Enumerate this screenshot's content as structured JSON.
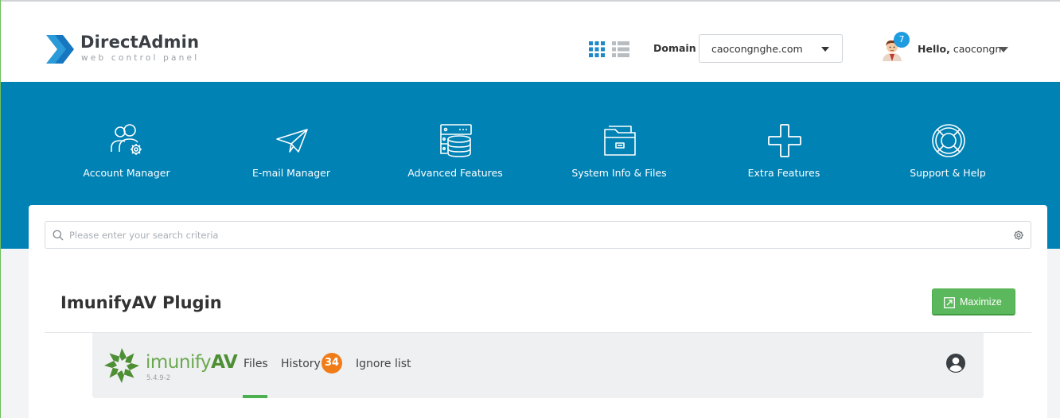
{
  "header": {
    "logo_name": "DirectAdmin",
    "logo_tagline": "web control panel",
    "domain_label": "Domain",
    "domain_value": "caocongnghe.com",
    "notification_count": "7",
    "hello_prefix": "Hello,",
    "username": "caocongn"
  },
  "nav": {
    "items": [
      {
        "label": "Account Manager",
        "icon": "users-gear-icon"
      },
      {
        "label": "E-mail Manager",
        "icon": "paper-plane-icon"
      },
      {
        "label": "Advanced Features",
        "icon": "server-database-icon"
      },
      {
        "label": "System Info & Files",
        "icon": "folder-icon"
      },
      {
        "label": "Extra Features",
        "icon": "plus-icon"
      },
      {
        "label": "Support & Help",
        "icon": "lifebuoy-icon"
      }
    ]
  },
  "search": {
    "placeholder": "Please enter your search criteria"
  },
  "page": {
    "title": "ImunifyAV Plugin",
    "maximize_label": "Maximize"
  },
  "plugin": {
    "brand_prefix": "imunify",
    "brand_suffix": "AV",
    "version": "5.4.9-2",
    "tabs": {
      "files": "Files",
      "history": "History",
      "history_count": "34",
      "ignore": "Ignore list"
    },
    "active_tab": "Files"
  },
  "colors": {
    "nav_blue": "#0082b5",
    "maximize_green": "#5cb85c",
    "imunify_green": "#6aa84f",
    "history_badge": "#f07c18",
    "notif_badge": "#1e9ce0"
  }
}
